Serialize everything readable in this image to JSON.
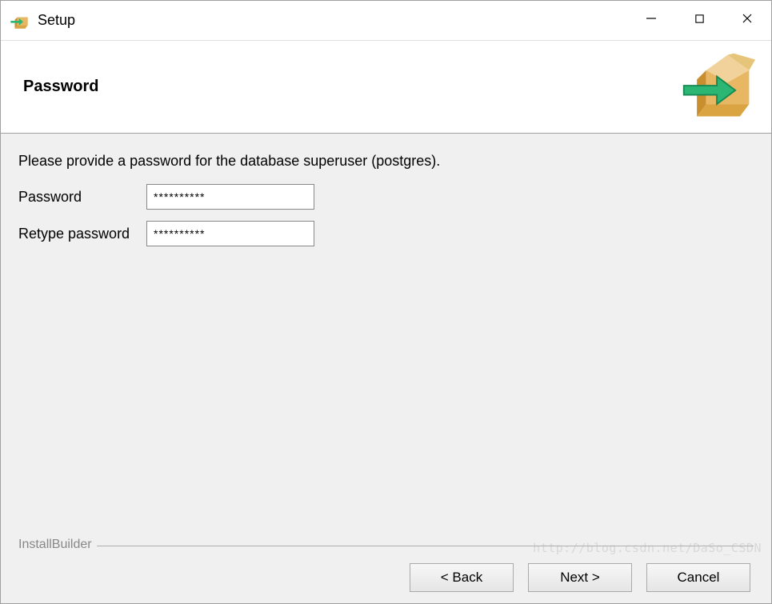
{
  "titlebar": {
    "title": "Setup"
  },
  "header": {
    "title": "Password"
  },
  "content": {
    "instruction": "Please provide a password for the database superuser (postgres).",
    "password_label": "Password",
    "password_value": "**********",
    "retype_label": "Retype password",
    "retype_value": "**********"
  },
  "footer": {
    "brand": "InstallBuilder",
    "back": "< Back",
    "next": "Next >",
    "cancel": "Cancel"
  },
  "watermark": "http://blog.csdn.net/DaSo_CSDN"
}
